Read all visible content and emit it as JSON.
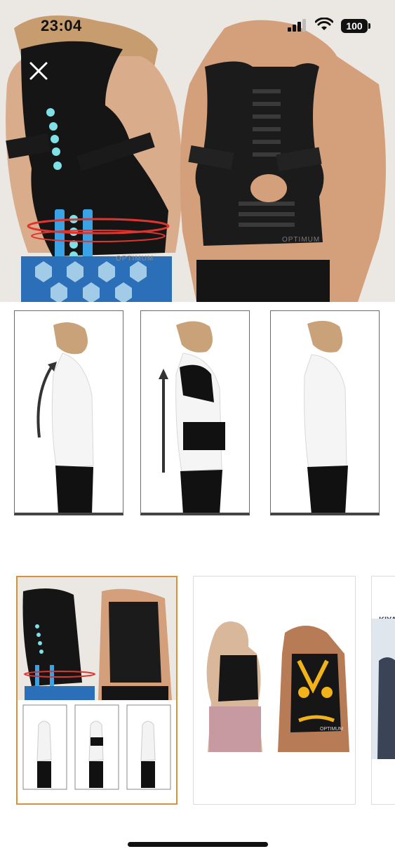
{
  "status_bar": {
    "time": "23:04",
    "battery": "100",
    "icons": [
      "signal-icon",
      "wifi-icon",
      "battery-icon"
    ]
  },
  "main_image": {
    "brand_text": "OPTIMUM",
    "brand_text_2": "OPTIMUM",
    "close_icon": "close-icon"
  },
  "posture_panels": [
    {
      "stage": "before"
    },
    {
      "stage": "with-brace"
    },
    {
      "stage": "after"
    }
  ],
  "thumbnails": {
    "selected_index": 0,
    "items": [
      {
        "label": ""
      },
      {
        "brand_text": "OPTIMUM"
      },
      {
        "brand_text": "KIYA"
      }
    ]
  },
  "colors": {
    "selected_border": "#d9923a",
    "brace": "#111111",
    "magnet_dots": "#7fe0e8",
    "support_strip": "#3aa3e6",
    "red_lines": "#e0342f"
  }
}
